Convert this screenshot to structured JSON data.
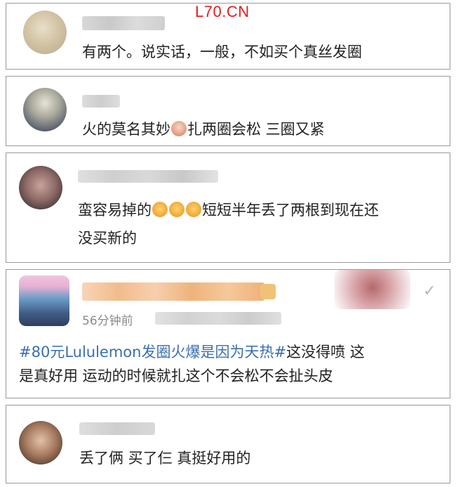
{
  "watermark": "L70.CN",
  "comments": [
    {
      "text": "有两个。说实话，一般，不如买个真丝发圈"
    },
    {
      "text_before": "火的莫名其妙",
      "text_after": "扎两圈会松 三圈又紧"
    },
    {
      "line1_before": "蛮容易掉的",
      "line1_after": "短短半年丢了两根到现在还",
      "line2": "没买新的"
    },
    {
      "time": "56分钟前",
      "topic": "#80元Lululemon发圈火爆是因为天热#",
      "line1_after": "这没得喷 这",
      "line2": "是真好用 运动的时候就扎这个不会松不会扯头皮"
    },
    {
      "text": "丢了俩 买了仨 真挺好用的"
    }
  ],
  "icons": {
    "expand": "chevron-check-icon"
  },
  "colors": {
    "watermark": "#e02020",
    "topic": "#3a6fb0",
    "border": "#9a9a9a"
  }
}
